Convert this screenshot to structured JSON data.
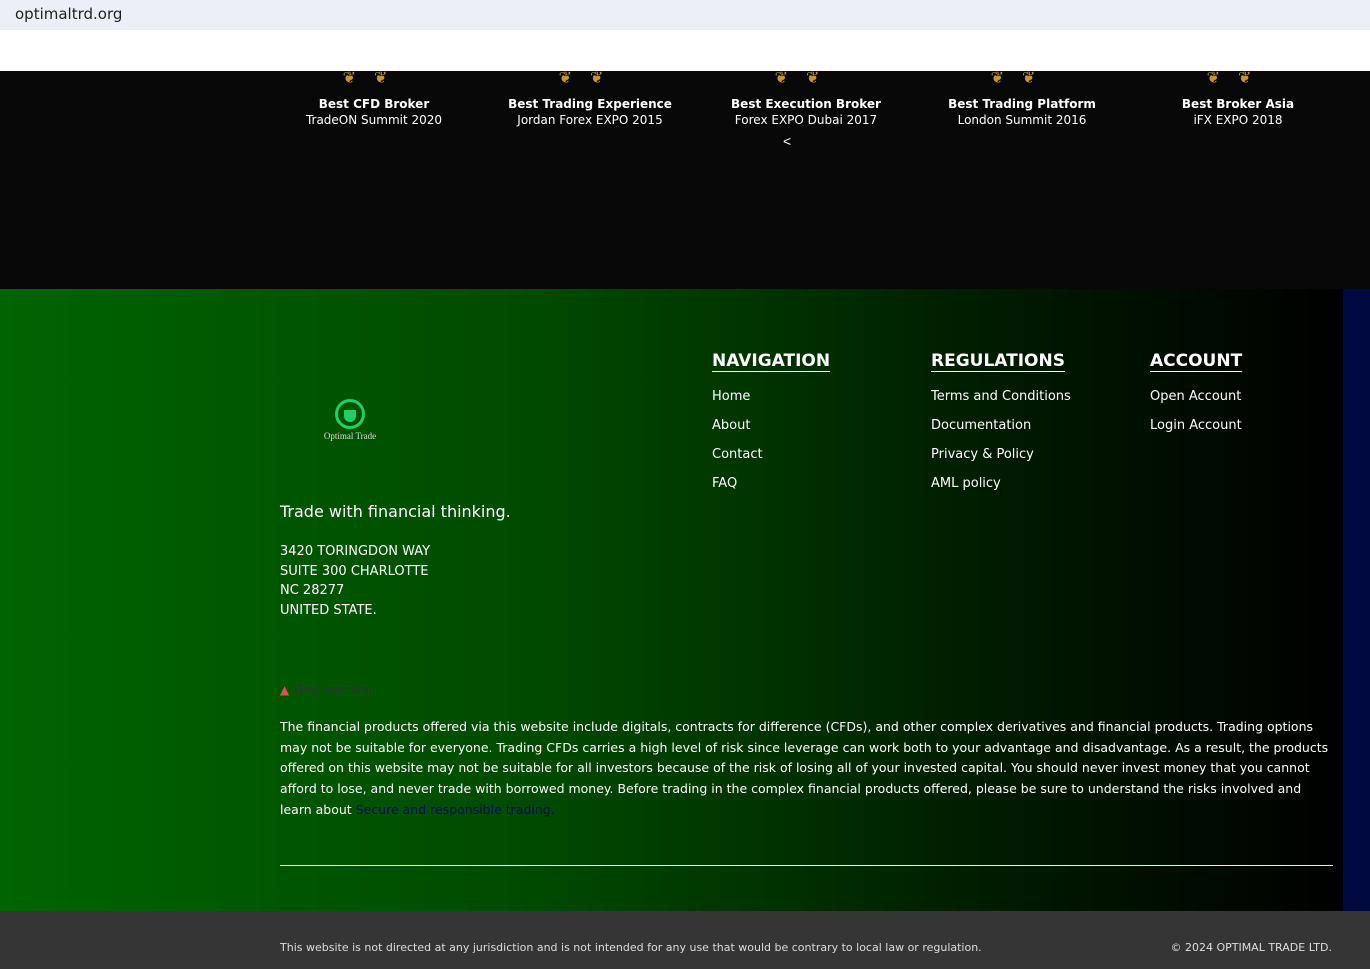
{
  "browser": {
    "url": "optimaltrd.org"
  },
  "awards": [
    {
      "title": "Best CFD Broker",
      "event": "TradeON Summit 2020"
    },
    {
      "title": "Best Trading Experience",
      "event": "Jordan Forex EXPO 2015"
    },
    {
      "title": "Best Execution Broker",
      "event": "Forex EXPO Dubai 2017"
    },
    {
      "title": "Best Trading Platform",
      "event": "London Summit 2016"
    },
    {
      "title": "Best Broker Asia",
      "event": "iFX EXPO 2018"
    }
  ],
  "carousel_prev": "<",
  "footer": {
    "logo_text": "Optimal Trade",
    "tagline": "Trade with financial thinking.",
    "address": [
      "3420 TORINGDON WAY",
      "SUITE 300 CHARLOTTE",
      "NC 28277",
      "UNITED STATE."
    ],
    "navigation": {
      "heading": "NAVIGATION",
      "links": [
        "Home",
        "About",
        "Contact",
        "FAQ"
      ]
    },
    "regulations": {
      "heading": "REGULATIONS",
      "links": [
        "Terms and Conditions",
        "Documentation",
        "Privacy & Policy",
        "AML policy"
      ]
    },
    "account": {
      "heading": "ACCOUNT",
      "links": [
        "Open Account",
        "Login Account"
      ]
    },
    "risk_title": "Risk warning",
    "risk_text": "The financial products offered via this website include digitals, contracts for difference (CFDs), and other complex derivatives and financial products. Trading options may not be suitable for everyone. Trading CFDs carries a high level of risk since leverage can work both to your advantage and disadvantage. As a result, the products offered on this website may not be suitable for all investors because of the risk of losing all of your invested capital. You should never invest money that you cannot afford to lose, and never trade with borrowed money. Before trading in the complex financial products offered, please be sure to understand the risks involved and learn about ",
    "risk_link": "Secure and responsible trading."
  },
  "bottom": {
    "disclaimer": "This website is not directed at any jurisdiction and is not intended for any use that would be contrary to local law or regulation.",
    "copyright": "© 2024 OPTIMAL TRADE LTD."
  }
}
